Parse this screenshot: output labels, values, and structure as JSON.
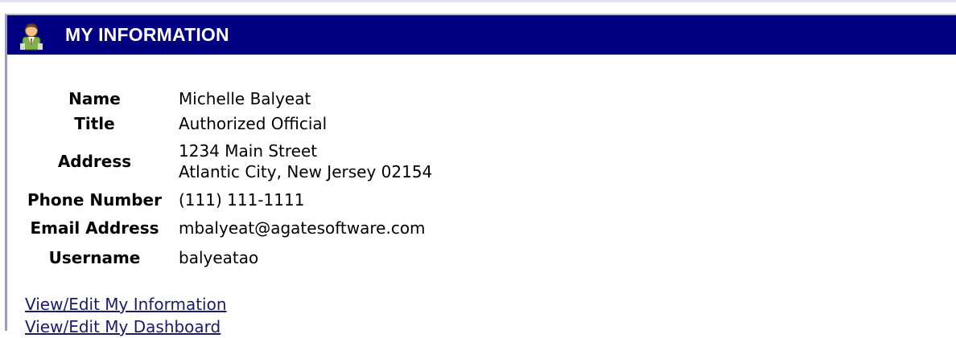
{
  "panel": {
    "title": "MY INFORMATION",
    "header_icon": "user-icon",
    "header_color": "#000080"
  },
  "fields": {
    "name": {
      "label": "Name",
      "value": "Michelle Balyeat"
    },
    "title": {
      "label": "Title",
      "value": "Authorized Official"
    },
    "address": {
      "label": "Address",
      "line1": "1234 Main Street",
      "line2": "Atlantic City, New Jersey 02154"
    },
    "phone": {
      "label": "Phone Number",
      "value": "(111) 111-1111"
    },
    "email": {
      "label": "Email Address",
      "value": "mbalyeat@agatesoftware.com"
    },
    "username": {
      "label": "Username",
      "value": "balyeatao"
    }
  },
  "links": {
    "edit_info": "View/Edit My Information",
    "edit_dashboard": "View/Edit My Dashboard"
  }
}
